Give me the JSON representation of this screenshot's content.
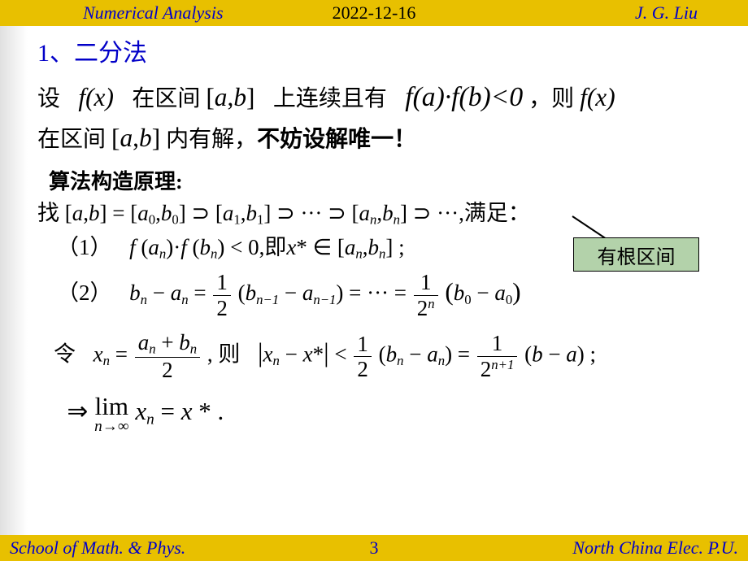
{
  "header": {
    "course": "Numerical Analysis",
    "date": "2022-12-16",
    "author": "J. G. Liu"
  },
  "footer": {
    "school": "School of Math. & Phys.",
    "page": "3",
    "university": "North China Elec. P.U."
  },
  "title": "1、二分法",
  "intro_line1_a": "设",
  "intro_fx": "f(x)",
  "intro_line1_b": "在区间",
  "intro_ab": "[a,b]",
  "intro_line1_c": "上连续且有",
  "intro_cond": "f(a)·f(b)<0",
  "intro_line1_d": "，则",
  "intro_line2_a": "在区间",
  "intro_line2_b": "内有解，",
  "intro_line2_c": "不妨设解唯一！",
  "subhead": "算法构造原理:",
  "find_label": "找",
  "satisfy_label": ",满足：",
  "bullet1": "（1）",
  "bullet1_text_mid": ",即",
  "bullet2a": "（2）",
  "let": "令",
  "then": "则",
  "implies": "⇒",
  "callout": "有根区间"
}
